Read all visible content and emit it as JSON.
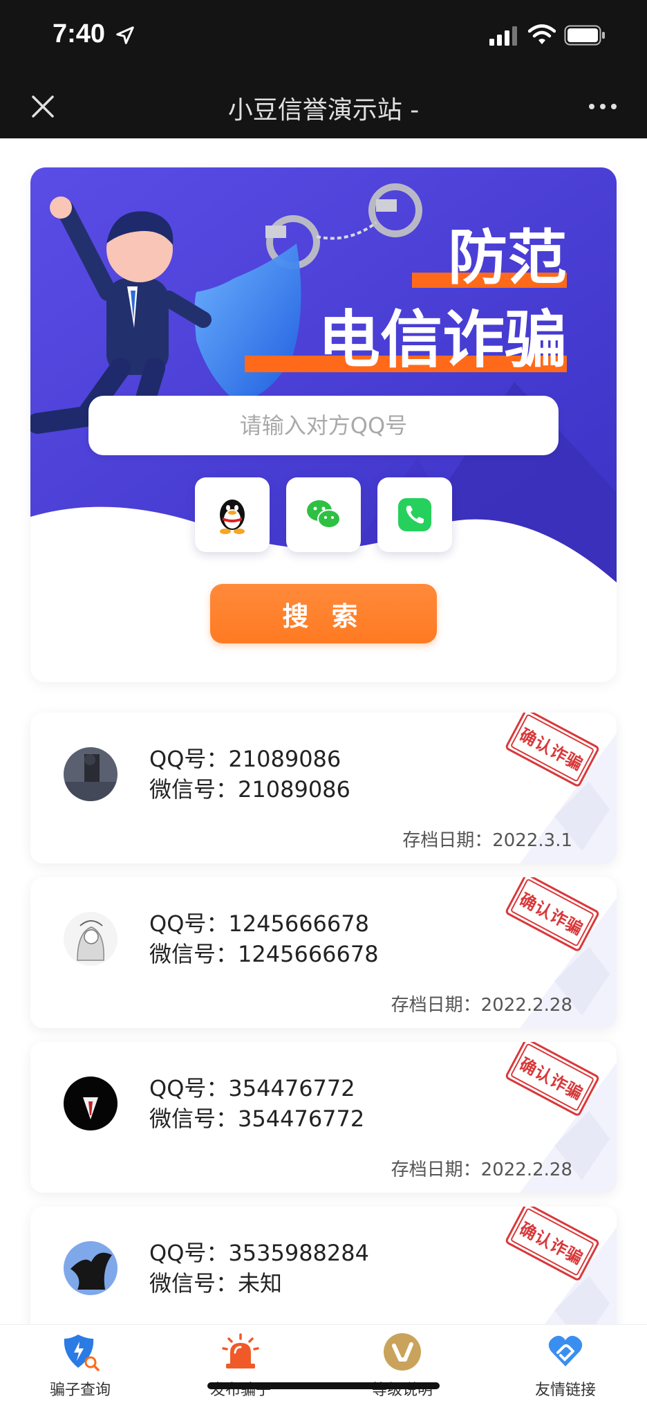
{
  "status_bar": {
    "time": "7:40"
  },
  "nav": {
    "title": "小豆信誉演示站 -"
  },
  "hero": {
    "banner_title_line1": "防范",
    "banner_title_line2": "电信诈骗",
    "search_placeholder": "请输入对方QQ号",
    "search_button": "搜 索",
    "type_buttons": [
      "qq-icon",
      "wechat-icon",
      "phone-icon"
    ]
  },
  "records": [
    {
      "qq_label": "QQ号：",
      "qq": "21089086",
      "wx_label": "微信号：",
      "wx": "21089086",
      "date_label": "存档日期：",
      "date": "2022.3.1",
      "stamp": "确认诈骗"
    },
    {
      "qq_label": "QQ号：",
      "qq": "1245666678",
      "wx_label": "微信号：",
      "wx": "1245666678",
      "date_label": "存档日期：",
      "date": "2022.2.28",
      "stamp": "确认诈骗"
    },
    {
      "qq_label": "QQ号：",
      "qq": "354476772",
      "wx_label": "微信号：",
      "wx": "354476772",
      "date_label": "存档日期：",
      "date": "2022.2.28",
      "stamp": "确认诈骗"
    },
    {
      "qq_label": "QQ号：",
      "qq": "3535988284",
      "wx_label": "微信号：",
      "wx": "未知",
      "stamp": "确认诈骗"
    }
  ],
  "tabs": [
    {
      "label": "骗子查询",
      "icon": "shield-search-icon"
    },
    {
      "label": "发布骗子",
      "icon": "alarm-icon"
    },
    {
      "label": "等级说明",
      "icon": "vip-icon"
    },
    {
      "label": "友情链接",
      "icon": "heart-link-icon"
    }
  ],
  "colors": {
    "accent": "#ff7a22",
    "banner": "#4b3fd8",
    "stamp": "#d9383a"
  }
}
